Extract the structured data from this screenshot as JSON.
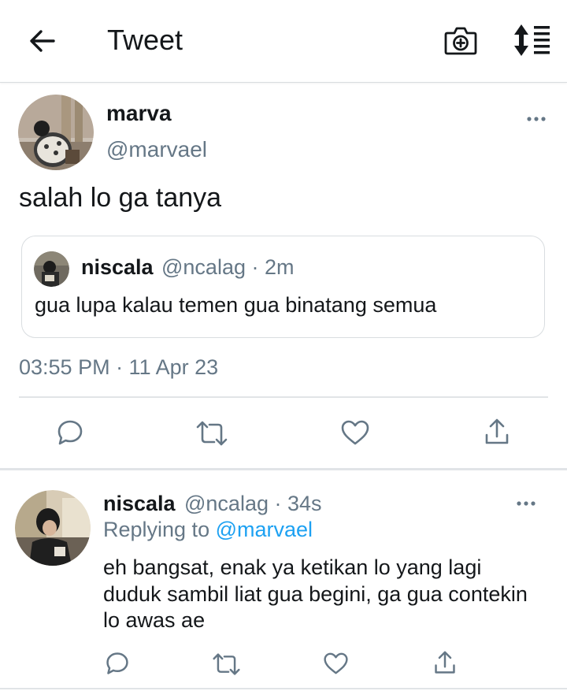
{
  "header": {
    "title": "Tweet"
  },
  "main_tweet": {
    "display_name": "marva",
    "handle": "@marvael",
    "text": "salah lo ga tanya",
    "timestamp": "03:55 PM · 11 Apr 23",
    "quote": {
      "display_name": "niscala",
      "handle_time": "@ncalag · 2m",
      "text": "gua lupa kalau temen gua binatang semua"
    }
  },
  "reply": {
    "display_name": "niscala",
    "handle_time": "@ncalag · 34s",
    "replying_prefix": "Replying to",
    "replying_handle": "@marvael",
    "text": "eh bangsat, enak ya ketikan lo yang lagi duduk sambil liat gua begini, ga gua contekin lo awas ae"
  },
  "colors": {
    "accent": "#1da1f2",
    "secondary_text": "#657786",
    "icon": "#657786"
  }
}
